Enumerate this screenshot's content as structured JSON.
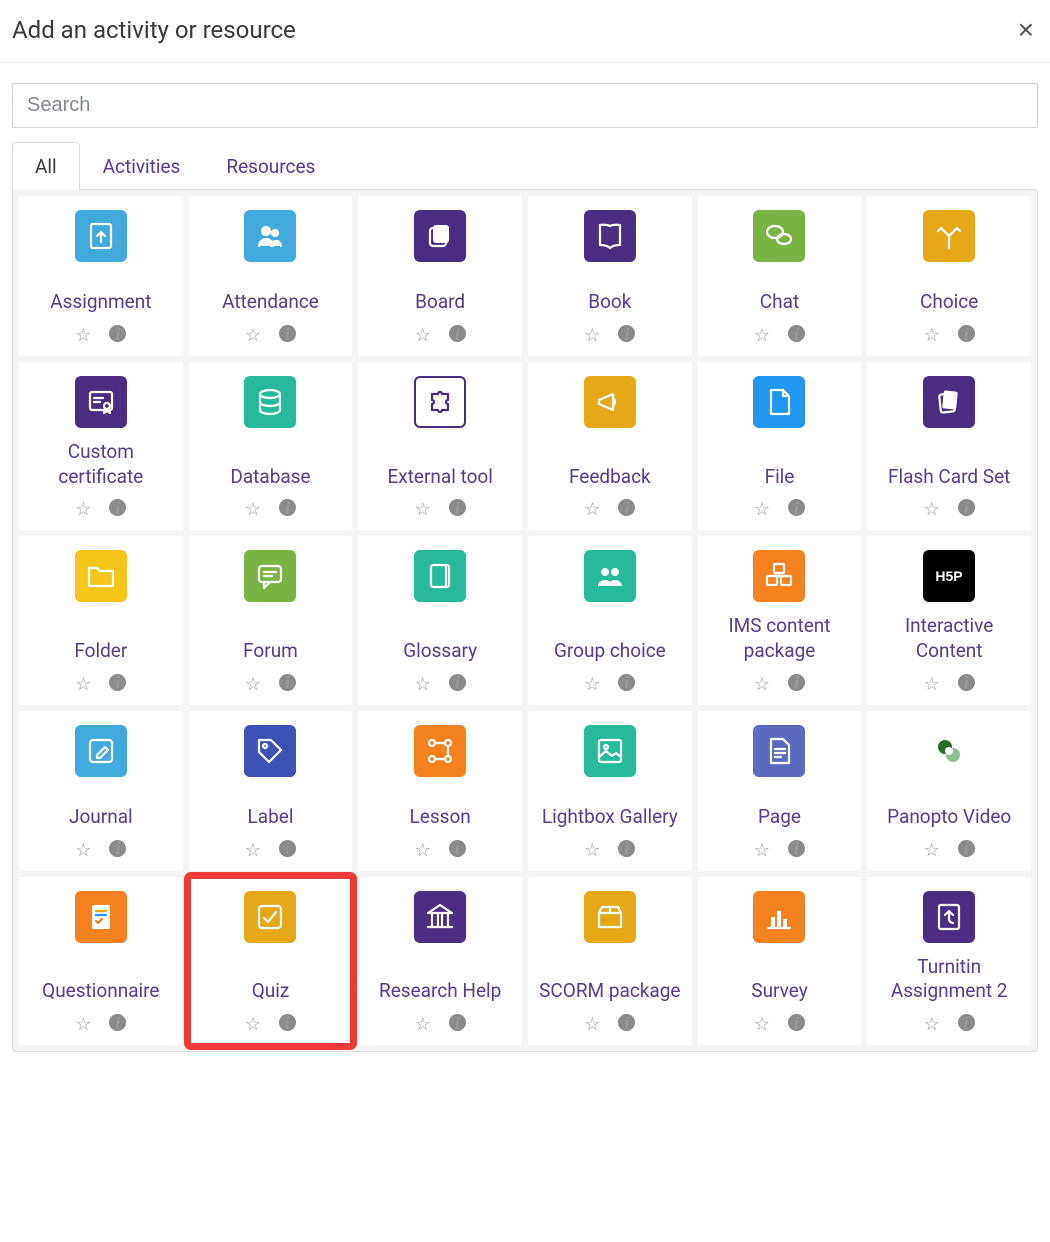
{
  "header": {
    "title": "Add an activity or resource"
  },
  "search": {
    "placeholder": "Search"
  },
  "tabs": [
    {
      "id": "all",
      "label": "All",
      "active": true
    },
    {
      "id": "activities",
      "label": "Activities",
      "active": false
    },
    {
      "id": "resources",
      "label": "Resources",
      "active": false
    }
  ],
  "items": [
    {
      "id": "assignment",
      "label": "Assignment",
      "icon": "upload-doc",
      "bg": "#42a9dc",
      "fg": "#fff"
    },
    {
      "id": "attendance",
      "label": "Attendance",
      "icon": "group",
      "bg": "#42a9dc",
      "fg": "#fff"
    },
    {
      "id": "board",
      "label": "Board",
      "icon": "stack",
      "bg": "#4b2e83",
      "fg": "#fff"
    },
    {
      "id": "book",
      "label": "Book",
      "icon": "book",
      "bg": "#4b2e83",
      "fg": "#fff"
    },
    {
      "id": "chat",
      "label": "Chat",
      "icon": "chat",
      "bg": "#7cb342",
      "fg": "#fff"
    },
    {
      "id": "choice",
      "label": "Choice",
      "icon": "fork",
      "bg": "#e6a817",
      "fg": "#fff"
    },
    {
      "id": "custom-certificate",
      "label": "Custom certificate",
      "icon": "cert",
      "bg": "#4b2e83",
      "fg": "#fff"
    },
    {
      "id": "database",
      "label": "Database",
      "icon": "db",
      "bg": "#26b99a",
      "fg": "#fff"
    },
    {
      "id": "external-tool",
      "label": "External tool",
      "icon": "puzzle",
      "bg": "#ffffff",
      "fg": "#4b2e83",
      "border": true
    },
    {
      "id": "feedback",
      "label": "Feedback",
      "icon": "megaphone",
      "bg": "#e6a817",
      "fg": "#fff"
    },
    {
      "id": "file",
      "label": "File",
      "icon": "file",
      "bg": "#2196f3",
      "fg": "#fff"
    },
    {
      "id": "flash-card-set",
      "label": "Flash Card Set",
      "icon": "cards",
      "bg": "#4b2e83",
      "fg": "#fff"
    },
    {
      "id": "folder",
      "label": "Folder",
      "icon": "folder",
      "bg": "#f5c518",
      "fg": "#fff"
    },
    {
      "id": "forum",
      "label": "Forum",
      "icon": "comment",
      "bg": "#7cb342",
      "fg": "#fff"
    },
    {
      "id": "glossary",
      "label": "Glossary",
      "icon": "notebook",
      "bg": "#26b99a",
      "fg": "#fff"
    },
    {
      "id": "group-choice",
      "label": "Group choice",
      "icon": "users",
      "bg": "#26b99a",
      "fg": "#fff"
    },
    {
      "id": "ims-content-package",
      "label": "IMS content package",
      "icon": "boxes",
      "bg": "#f5821f",
      "fg": "#fff"
    },
    {
      "id": "interactive-content",
      "label": "Interactive Content",
      "icon": "h5p",
      "bg": "#000000",
      "fg": "#fff"
    },
    {
      "id": "journal",
      "label": "Journal",
      "icon": "edit",
      "bg": "#42a9dc",
      "fg": "#fff"
    },
    {
      "id": "label",
      "label": "Label",
      "icon": "tag",
      "bg": "#3f51b5",
      "fg": "#fff"
    },
    {
      "id": "lesson",
      "label": "Lesson",
      "icon": "path",
      "bg": "#f5821f",
      "fg": "#fff"
    },
    {
      "id": "lightbox-gallery",
      "label": "Lightbox Gallery",
      "icon": "gallery",
      "bg": "#26b99a",
      "fg": "#fff"
    },
    {
      "id": "page",
      "label": "Page",
      "icon": "page",
      "bg": "#5c6bc0",
      "fg": "#fff"
    },
    {
      "id": "panopto-video",
      "label": "Panopto Video",
      "icon": "panopto",
      "bg": "#ffffff",
      "fg": "#5a8a3a"
    },
    {
      "id": "questionnaire",
      "label": "Questionnaire",
      "icon": "checklist-doc",
      "bg": "#f5821f",
      "fg": "#fff"
    },
    {
      "id": "quiz",
      "label": "Quiz",
      "icon": "check-box",
      "bg": "#e6a817",
      "fg": "#fff",
      "highlighted": true
    },
    {
      "id": "research-help",
      "label": "Research Help",
      "icon": "bank",
      "bg": "#4b2e83",
      "fg": "#fff"
    },
    {
      "id": "scorm-package",
      "label": "SCORM package",
      "icon": "package",
      "bg": "#e6a817",
      "fg": "#fff"
    },
    {
      "id": "survey",
      "label": "Survey",
      "icon": "barchart",
      "bg": "#f5821f",
      "fg": "#fff"
    },
    {
      "id": "turnitin-assignment-2",
      "label": "Turnitin Assignment 2",
      "icon": "turnitin",
      "bg": "#4b2e83",
      "fg": "#fff"
    }
  ],
  "icons": {
    "star": "☆",
    "info": "i",
    "close": "×"
  }
}
